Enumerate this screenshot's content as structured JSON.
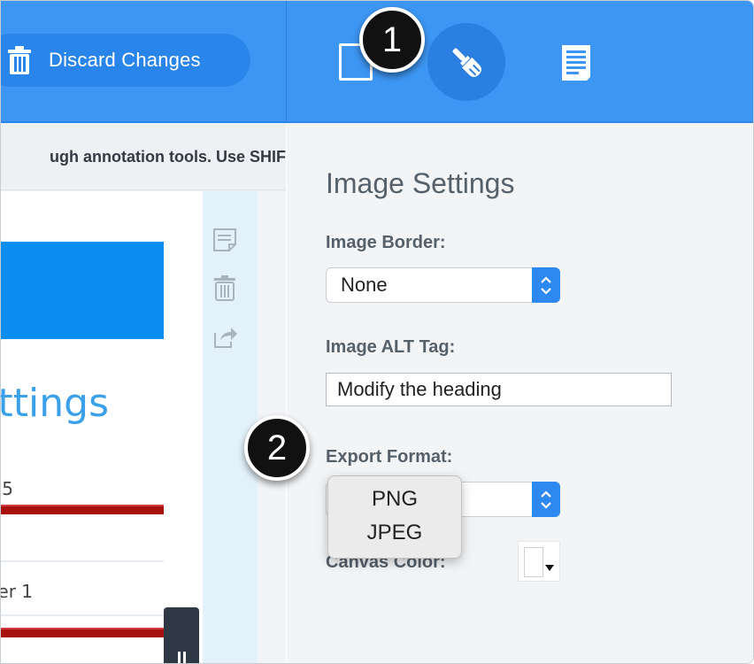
{
  "toolbar": {
    "discard_label": "Discard Changes"
  },
  "badges": {
    "first": "1",
    "second": "2"
  },
  "canvas": {
    "hint_text": "ugh annotation tools. Use SHIF",
    "heading_fragment": "ttings",
    "text_fragment_1": "5",
    "text_fragment_2": "er 1"
  },
  "settings": {
    "title": "Image Settings",
    "border_label": "Image Border:",
    "border_value": "None",
    "alt_label": "Image ALT Tag:",
    "alt_value": "Modify the heading",
    "export_label": "Export Format:",
    "export_options": [
      "PNG",
      "JPEG"
    ],
    "canvas_color_label": "Canvas Color:"
  },
  "colors": {
    "topbar": "#3d96f3",
    "accent_button": "#2a85ea",
    "active_tool": "#2a7fe0",
    "badge": "#111111",
    "red_bar": "#a8100f"
  },
  "icons": {
    "discard": "trash-icon",
    "crop": "crop-icon",
    "brush": "brush-icon",
    "document": "document-icon",
    "note": "note-icon",
    "delete": "trash-icon",
    "share": "share-icon"
  }
}
